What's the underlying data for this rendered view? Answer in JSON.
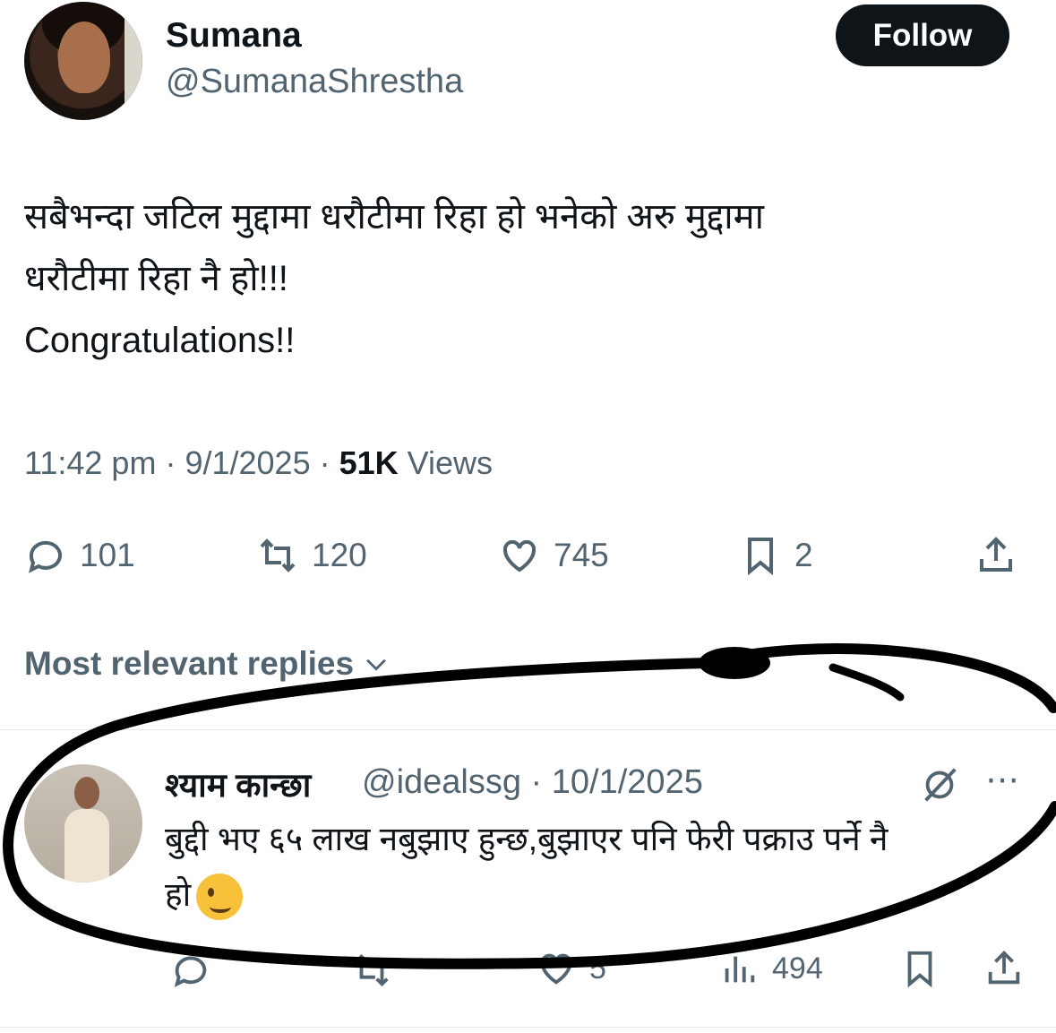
{
  "author": {
    "name": "Sumana",
    "handle": "@SumanaShrestha",
    "follow_label": "Follow"
  },
  "tweet": {
    "lines": [
      "सबैभन्दा जटिल मुद्दामा धरौटीमा रिहा हो भनेको अरु मुद्दामा",
      "धरौटीमा रिहा नै हो!!!",
      "Congratulations!!"
    ],
    "time": "11:42 pm",
    "date": "9/1/2025",
    "views_count": "51K",
    "views_label": "Views"
  },
  "actions": {
    "replies": "101",
    "reposts": "120",
    "likes": "745",
    "bookmarks": "2"
  },
  "replies_header": "Most relevant replies",
  "reply": {
    "name": "श्याम कान्छा",
    "handle": "@idealssg",
    "date": "10/1/2025",
    "lines": [
      "बुद्दी भए ६५ लाख नबुझाए हुन्छ,बुझाएर पनि फेरी पक्राउ पर्ने नै",
      "हो"
    ],
    "likes": "5",
    "views": "494"
  },
  "icons": [
    "reply-icon",
    "repost-icon",
    "like-icon",
    "bookmark-icon",
    "share-icon",
    "views-icon",
    "grok-icon",
    "more-icon",
    "chevron-down-icon"
  ]
}
